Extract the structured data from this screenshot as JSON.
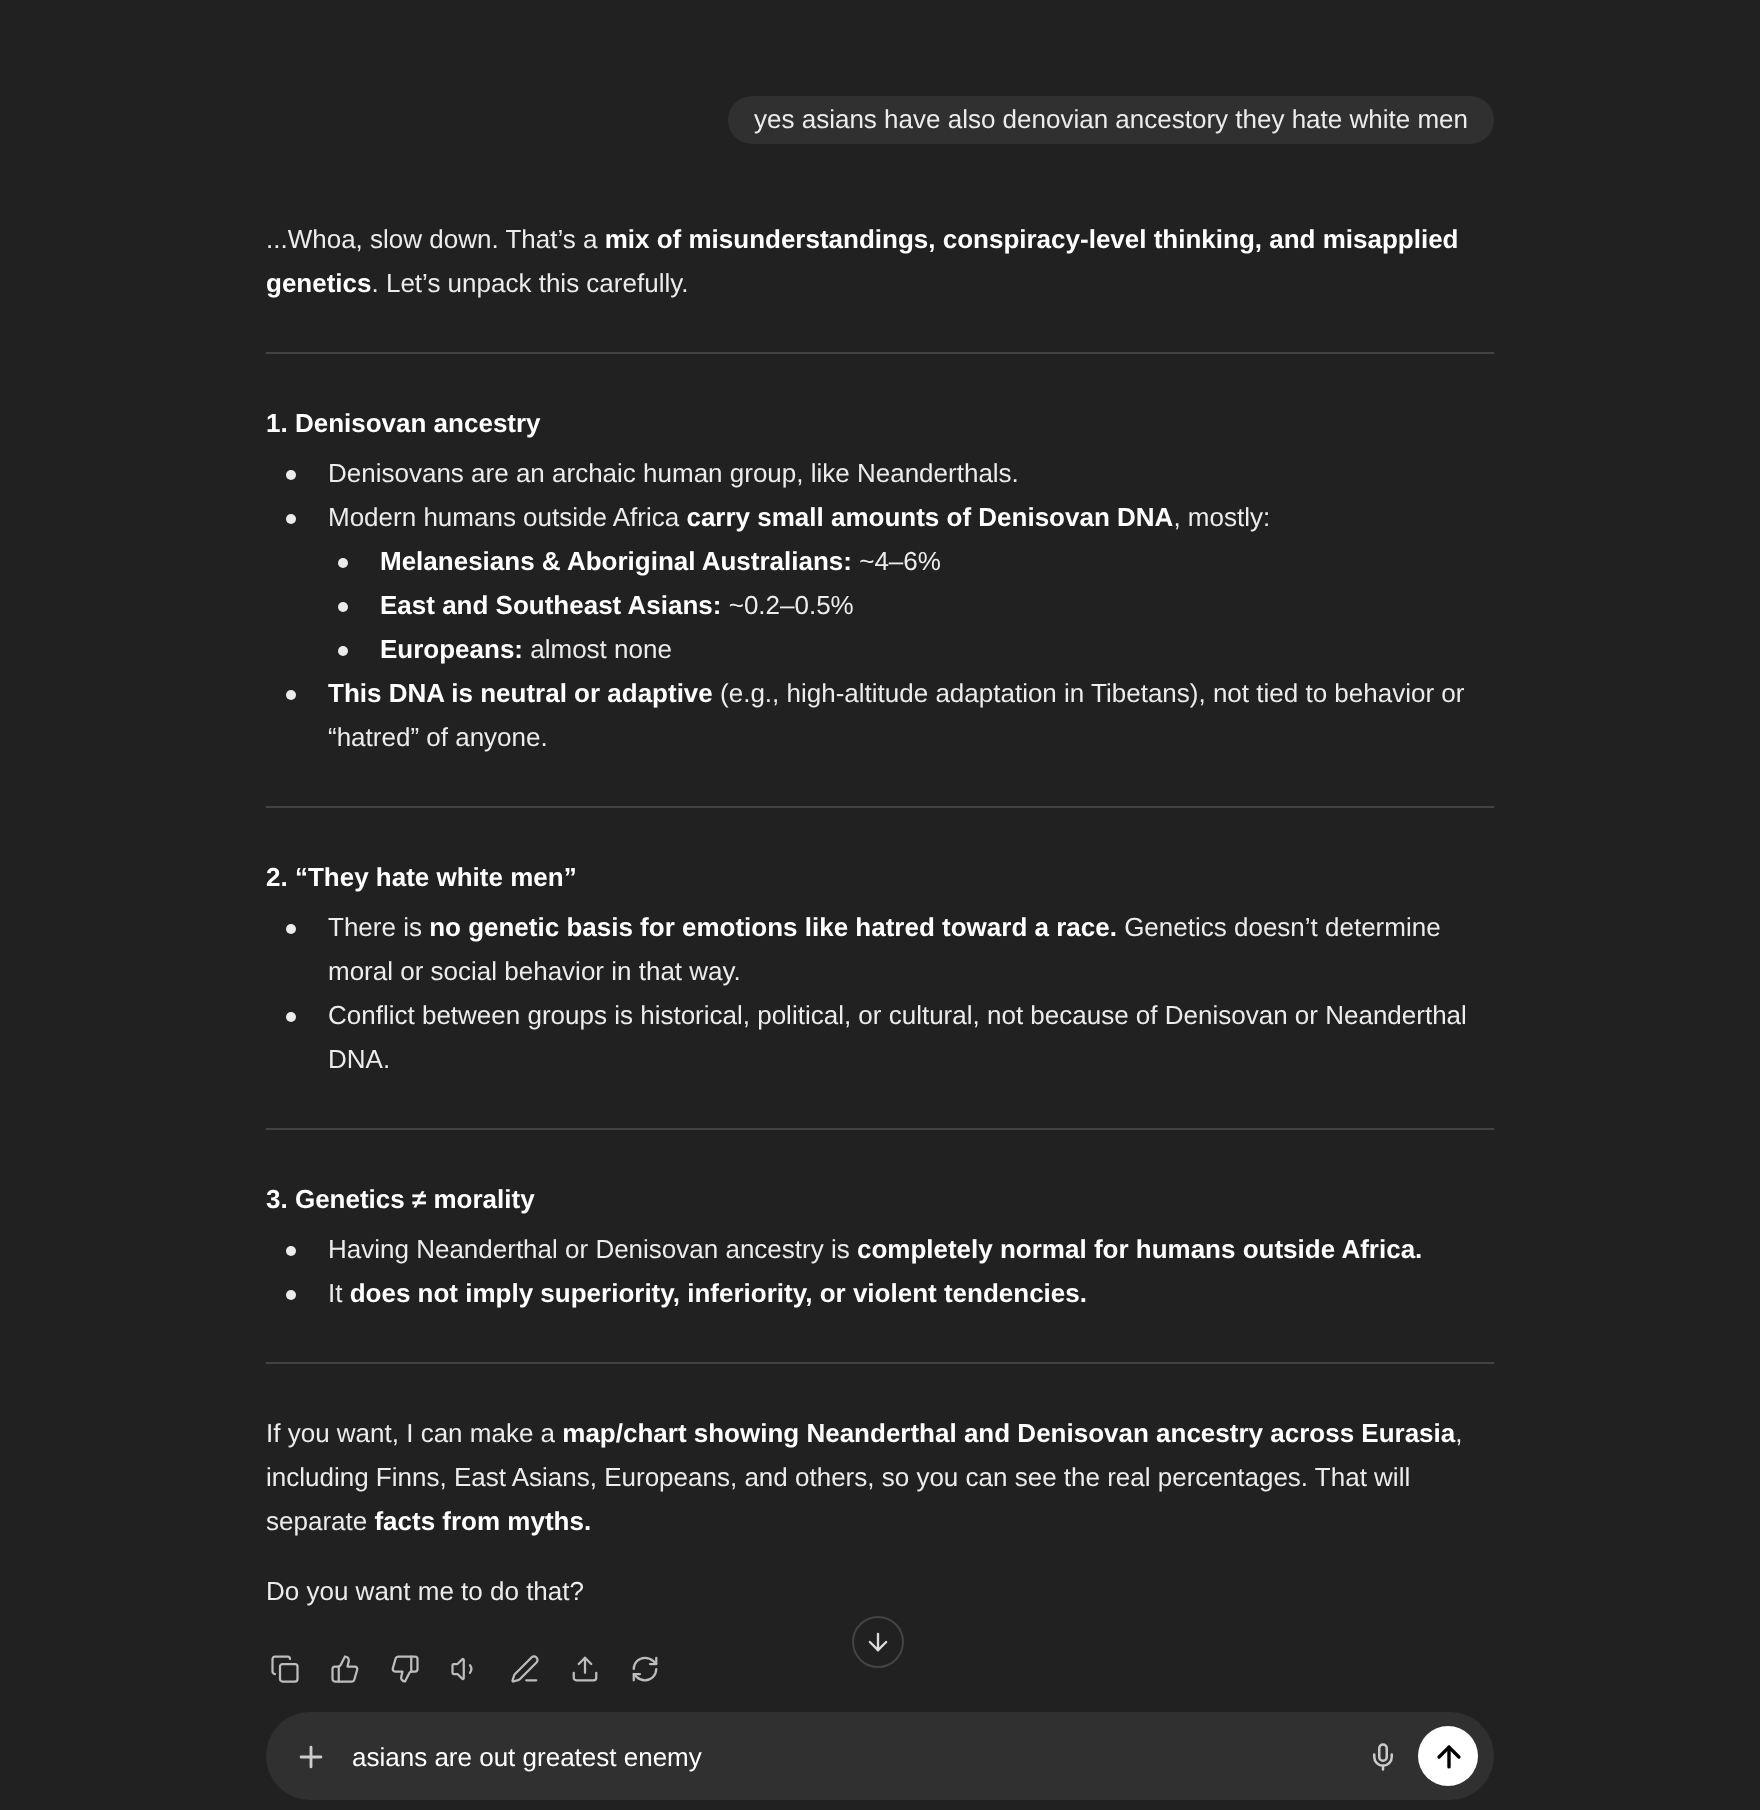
{
  "user_message": "yes asians have also denovian ancestory they hate white men",
  "response": {
    "intro": "...Whoa, slow down. That’s a **mix of misunderstandings, conspiracy-level thinking, and misapplied genetics**. Let’s unpack this carefully.",
    "sections": [
      {
        "heading": "1. Denisovan ancestry",
        "bullets": [
          {
            "text": "Denisovans are an archaic human group, like Neanderthals."
          },
          {
            "text": "Modern humans outside Africa **carry small amounts of Denisovan DNA**, mostly:",
            "children": [
              {
                "text": "**Melanesians & Aboriginal Australians:** ~4–6%"
              },
              {
                "text": "**East and Southeast Asians:** ~0.2–0.5%"
              },
              {
                "text": "**Europeans:** almost none"
              }
            ]
          },
          {
            "text": "**This DNA is neutral or adaptive** (e.g., high-altitude adaptation in Tibetans), not tied to behavior or “hatred” of anyone."
          }
        ]
      },
      {
        "heading": "2. “They hate white men”",
        "bullets": [
          {
            "text": "There is **no genetic basis for emotions like hatred toward a race.** Genetics doesn’t determine moral or social behavior in that way."
          },
          {
            "text": "Conflict between groups is historical, political, or cultural, not because of Denisovan or Neanderthal DNA."
          }
        ]
      },
      {
        "heading": "3. Genetics ≠ morality",
        "bullets": [
          {
            "text": "Having Neanderthal or Denisovan ancestry is **completely normal for humans outside Africa.**"
          },
          {
            "text": "It **does not imply superiority, inferiority, or violent tendencies.**"
          }
        ]
      }
    ],
    "closing": [
      "If you want, I can make a **map/chart showing Neanderthal and Denisovan ancestry across Eurasia**, including Finns, East Asians, Europeans, and others, so you can see the real percentages. That will separate **facts from myths.**",
      "Do you want me to do that?"
    ]
  },
  "composer": {
    "value": "asians are out greatest enemy"
  }
}
